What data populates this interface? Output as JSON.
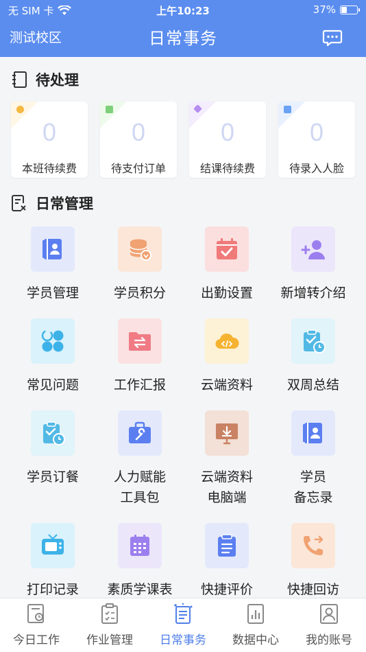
{
  "status_bar": {
    "carrier": "无 SIM 卡",
    "time": "上午10:23",
    "battery_text": "37%",
    "battery_level": 0.37
  },
  "header": {
    "school": "测试校区",
    "title": "日常事务"
  },
  "pending": {
    "title": "待处理",
    "cards": [
      {
        "value": "0",
        "label": "本班待续费",
        "color": "#f5b841"
      },
      {
        "value": "0",
        "label": "待支付订单",
        "color": "#7ed07a"
      },
      {
        "value": "0",
        "label": "结课待续费",
        "color": "#b58cf0"
      },
      {
        "value": "0",
        "label": "待录入人脸",
        "color": "#6aa3f5"
      }
    ]
  },
  "management": {
    "title": "日常管理",
    "items": [
      {
        "label": "学员管理",
        "icon": "contacts-icon",
        "bg": "#e3e9fb",
        "fg": "#5b7ff0"
      },
      {
        "label": "学员积分",
        "icon": "coins-icon",
        "bg": "#fbe6d8",
        "fg": "#f0a272"
      },
      {
        "label": "出勤设置",
        "icon": "calendar-check-icon",
        "bg": "#fbdede",
        "fg": "#f07a7a"
      },
      {
        "label": "新增转介绍",
        "icon": "add-user-icon",
        "bg": "#ece6fb",
        "fg": "#9c7fee"
      },
      {
        "label": "常见问题",
        "icon": "grid-apps-icon",
        "bg": "#d9f2fb",
        "fg": "#3db2e8"
      },
      {
        "label": "工作汇报",
        "icon": "folder-exchange-icon",
        "bg": "#fbe1e1",
        "fg": "#f07b85"
      },
      {
        "label": "云端资料",
        "icon": "cloud-code-icon",
        "bg": "#fdf1d6",
        "fg": "#f5b331"
      },
      {
        "label": "双周总结",
        "icon": "clipboard-clock-icon",
        "bg": "#e0f4fa",
        "fg": "#52b9e5"
      },
      {
        "label": "学员订餐",
        "icon": "clipboard-clock-icon",
        "bg": "#e0f4fa",
        "fg": "#52b9e5"
      },
      {
        "label": "人力赋能\n工具包",
        "icon": "toolbox-icon",
        "bg": "#e3e9fb",
        "fg": "#5b7ff0"
      },
      {
        "label": "云端资料\n电脑端",
        "icon": "monitor-download-icon",
        "bg": "#f3e0d6",
        "fg": "#c98364"
      },
      {
        "label": "学员\n备忘录",
        "icon": "contacts-icon",
        "bg": "#e3e9fb",
        "fg": "#5b7ff0"
      },
      {
        "label": "打印记录",
        "icon": "tv-icon",
        "bg": "#d9f2fb",
        "fg": "#3db2e8"
      },
      {
        "label": "素质学课表",
        "icon": "calendar-grid-icon",
        "bg": "#ece6fb",
        "fg": "#9c7fee"
      },
      {
        "label": "快捷评价",
        "icon": "clipboard-list-icon",
        "bg": "#e3e9fb",
        "fg": "#5b7ff0"
      },
      {
        "label": "快捷回访",
        "icon": "phone-callback-icon",
        "bg": "#fbe6d8",
        "fg": "#f0a272"
      }
    ]
  },
  "tabs": [
    {
      "label": "今日工作",
      "icon": "today-work-icon",
      "active": false
    },
    {
      "label": "作业管理",
      "icon": "homework-icon",
      "active": false
    },
    {
      "label": "日常事务",
      "icon": "daily-affairs-icon",
      "active": true
    },
    {
      "label": "数据中心",
      "icon": "data-center-icon",
      "active": false
    },
    {
      "label": "我的账号",
      "icon": "account-icon",
      "active": false
    }
  ],
  "colors": {
    "header_bg": "#5b8def",
    "active_tab": "#4f7fe8"
  }
}
